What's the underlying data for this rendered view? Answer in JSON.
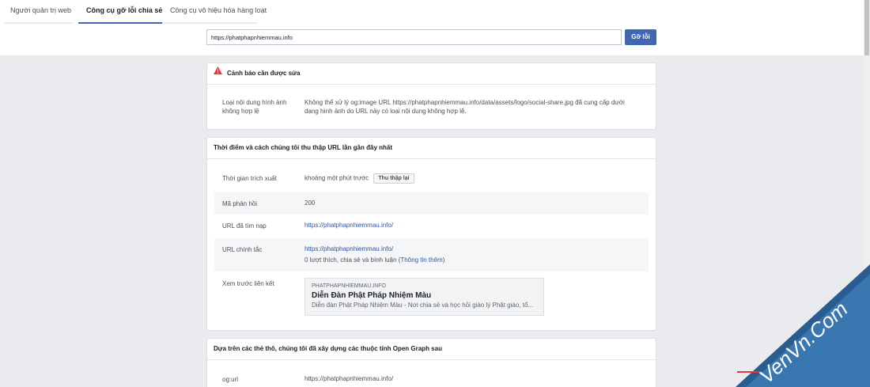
{
  "tabs": [
    {
      "label": "Người quản trị web"
    },
    {
      "label": "Công cụ gỡ lỗi chia sẻ"
    },
    {
      "label": "Công cụ vô hiệu hóa hàng loạt"
    }
  ],
  "search": {
    "value": "https://phatphapnhiemmau.info",
    "button_label": "Gỡ lỗi"
  },
  "warnings": {
    "title": "Cảnh báo cần được sửa",
    "label": "Loại nội dung hình ảnh không hợp lệ",
    "message": "Không thể xử lý og:image URL https://phatphapnhiemmau.info/data/assets/logo/social-share.jpg đã cung cấp dưới dạng hình ảnh do URL này có loại nội dung không hợp lệ."
  },
  "scrape": {
    "title": "Thời điểm và cách chúng tôi thu thập URL lần gần đây nhất",
    "rows": {
      "time_label": "Thời gian trích xuất",
      "time_value": "khoảng một phút trước",
      "refetch_label": "Thu thập lại",
      "response_label": "Mã phản hồi",
      "response_value": "200",
      "fetched_label": "URL đã tìm nạp",
      "fetched_value": "https://phatphapnhiemmau.info/",
      "canonical_label": "URL chính tắc",
      "canonical_value": "https://phatphapnhiemmau.info/",
      "engagement_text": "0 lượt thích, chia sẻ và bình luận (",
      "engagement_link": "Thông tin thêm",
      "engagement_close": ")",
      "preview_label": "Xem trước liên kết"
    },
    "preview": {
      "domain": "PHATPHAPNHIEMMAU.INFO",
      "title": "Diễn Đàn Phật Pháp Nhiệm Màu",
      "description": "Diễn đàn Phật Pháp Nhiệm Màu - Nơi chia sẻ và học hỏi giáo lý Phật giáo, tổ..."
    }
  },
  "opengraph": {
    "title": "Dựa trên các thẻ thô, chúng tôi đã xây dựng các thuộc tính Open Graph sau",
    "og_url_label": "og:url",
    "og_url_value": "https://phatphapnhiemmau.info/"
  },
  "watermark": {
    "text": "VenVn.Com"
  },
  "colors": {
    "accent": "#4267b2",
    "link": "#365899",
    "warning": "#e0393e"
  }
}
